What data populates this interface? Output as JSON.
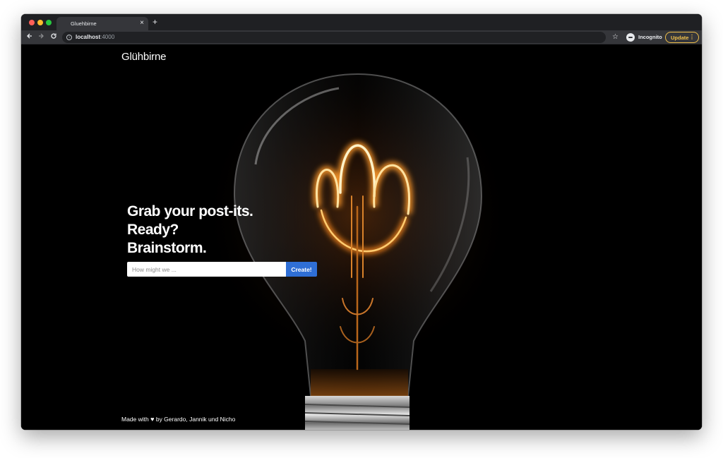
{
  "browser": {
    "tab_title": "Gluehbirne",
    "tab_close": "×",
    "new_tab": "+",
    "url_host": "localhost",
    "url_port": ":4000",
    "profile_label": "Incognito",
    "update_label": "Update",
    "update_menu": "⋮",
    "icons": [
      "back-icon",
      "forward-icon",
      "reload-icon",
      "info-icon",
      "star-icon",
      "incognito-icon"
    ]
  },
  "page": {
    "brand": "Glühbirne",
    "headline": {
      "line1": "Grab your post-its.",
      "line2": "Ready?",
      "line3": "Brainstorm."
    },
    "form": {
      "placeholder": "How might we ...",
      "submit_label": "Create!"
    },
    "footer": {
      "prefix": "Made with",
      "heart": "♥",
      "suffix": "by Gerardo, Jannik und Nicho"
    }
  },
  "colors": {
    "accent": "#2f6fd6",
    "update": "#f1c04a",
    "filament": "#ffb347"
  }
}
